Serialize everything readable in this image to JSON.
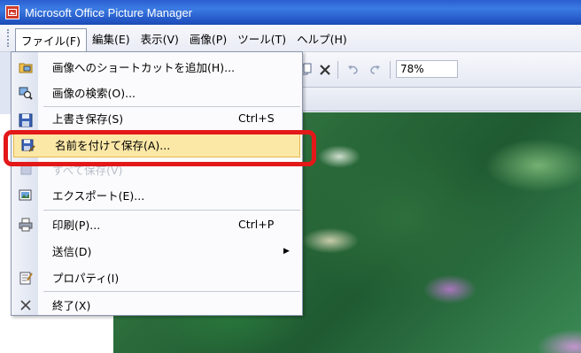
{
  "window": {
    "title": "Microsoft Office Picture Manager"
  },
  "menubar": {
    "items": [
      {
        "label": "ファイル(F)",
        "underline": "F"
      },
      {
        "label": "編集(E)"
      },
      {
        "label": "表示(V)"
      },
      {
        "label": "画像(P)"
      },
      {
        "label": "ツール(T)"
      },
      {
        "label": "ヘルプ(H)"
      }
    ]
  },
  "toolbar": {
    "zoom": "78%"
  },
  "file_menu": {
    "items": [
      {
        "label": "画像へのショートカットを追加(H)...",
        "icon": "add-shortcut-icon"
      },
      {
        "label": "画像の検索(O)...",
        "icon": "find-pictures-icon"
      },
      {
        "label": "上書き保存(S)",
        "shortcut": "Ctrl+S",
        "icon": "save-icon"
      },
      {
        "label": "名前を付けて保存(A)...",
        "icon": "save-as-icon",
        "highlighted": true
      },
      {
        "label": "すべて保存(V)",
        "icon": "save-all-icon",
        "disabled": true
      },
      {
        "label": "エクスポート(E)...",
        "icon": "export-icon"
      },
      {
        "label": "印刷(P)...",
        "shortcut": "Ctrl+P",
        "icon": "print-icon"
      },
      {
        "label": "送信(D)",
        "icon": "",
        "submenu": true
      },
      {
        "label": "プロパティ(I)",
        "icon": "properties-icon"
      },
      {
        "label": "終了(X)",
        "icon": "close-icon"
      }
    ]
  },
  "colors": {
    "titlebar": "#2a5fd0",
    "highlight": "#fce8a6",
    "annotation": "#e31818"
  }
}
